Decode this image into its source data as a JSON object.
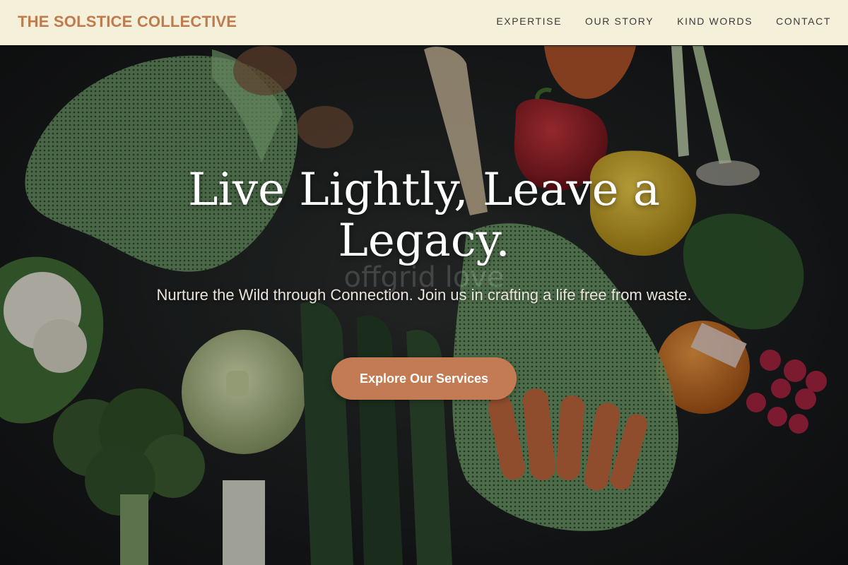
{
  "header": {
    "brand": "THE SOLSTICE COLLECTIVE",
    "nav": [
      "EXPERTISE",
      "OUR STORY",
      "KIND WORDS",
      "CONTACT"
    ]
  },
  "hero": {
    "headline": "Live Lightly, Leave a Legacy.",
    "subheadline": "Nurture the Wild through Connection. Join us in crafting a life free from waste.",
    "cta_label": "Explore Our Services",
    "watermark": "offgrid love",
    "image_subject": "vegetables in green mesh produce bags on dark background"
  },
  "colors": {
    "brand": "#c07a4d",
    "nav_background": "#fcf8e0",
    "cta": "#c27b52",
    "hero_text": "#ffffff"
  }
}
